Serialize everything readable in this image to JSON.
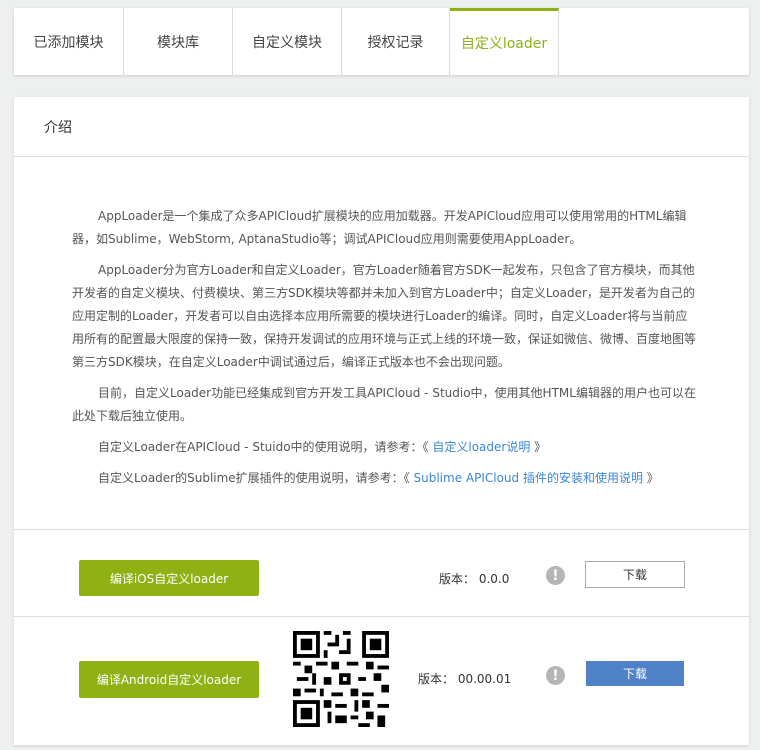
{
  "tabs": [
    {
      "label": "已添加模块"
    },
    {
      "label": "模块库"
    },
    {
      "label": "自定义模块"
    },
    {
      "label": "授权记录"
    },
    {
      "label": "自定义loader"
    }
  ],
  "panel": {
    "title": "介绍",
    "paragraphs": [
      "AppLoader是一个集成了众多APICloud扩展模块的应用加载器。开发APICloud应用可以使用常用的HTML编辑器，如Sublime，WebStorm, AptanaStudio等；调试APICloud应用则需要使用AppLoader。",
      "AppLoader分为官方Loader和自定义Loader，官方Loader随着官方SDK一起发布，只包含了官方模块，而其他开发者的自定义模块、付费模块、第三方SDK模块等都并未加入到官方Loader中；自定义Loader，是开发者为自己的应用定制的Loader，开发者可以自由选择本应用所需要的模块进行Loader的编译。同时，自定义Loader将与当前应用所有的配置最大限度的保持一致，保持开发调试的应用环境与正式上线的环境一致，保证如微信、微博、百度地图等第三方SDK模块，在自定义Loader中调试通过后，编译正式版本也不会出现问题。",
      "目前，自定义Loader功能已经集成到官方开发工具APICloud - Studio中，使用其他HTML编辑器的用户也可以在此处下载后独立使用。"
    ],
    "ref1": {
      "prefix": "自定义Loader在APICloud - Stuido中的使用说明，请参考：《 ",
      "link": "自定义loader说明",
      "suffix": " 》"
    },
    "ref2": {
      "prefix": "自定义Loader的Sublime扩展插件的使用说明，请参考：《 ",
      "link": "Sublime APICloud 插件的安装和使用说明",
      "suffix": " 》"
    }
  },
  "ios": {
    "button": "编译iOS自定义loader",
    "version": "版本： 0.0.0",
    "download": "下载"
  },
  "android": {
    "button": "编译Android自定义loader",
    "version": "版本： 00.00.01",
    "download": "下载"
  },
  "colors": {
    "accent": "#8fb114",
    "blue_button": "#4f81c7",
    "link": "#3b86d8"
  }
}
